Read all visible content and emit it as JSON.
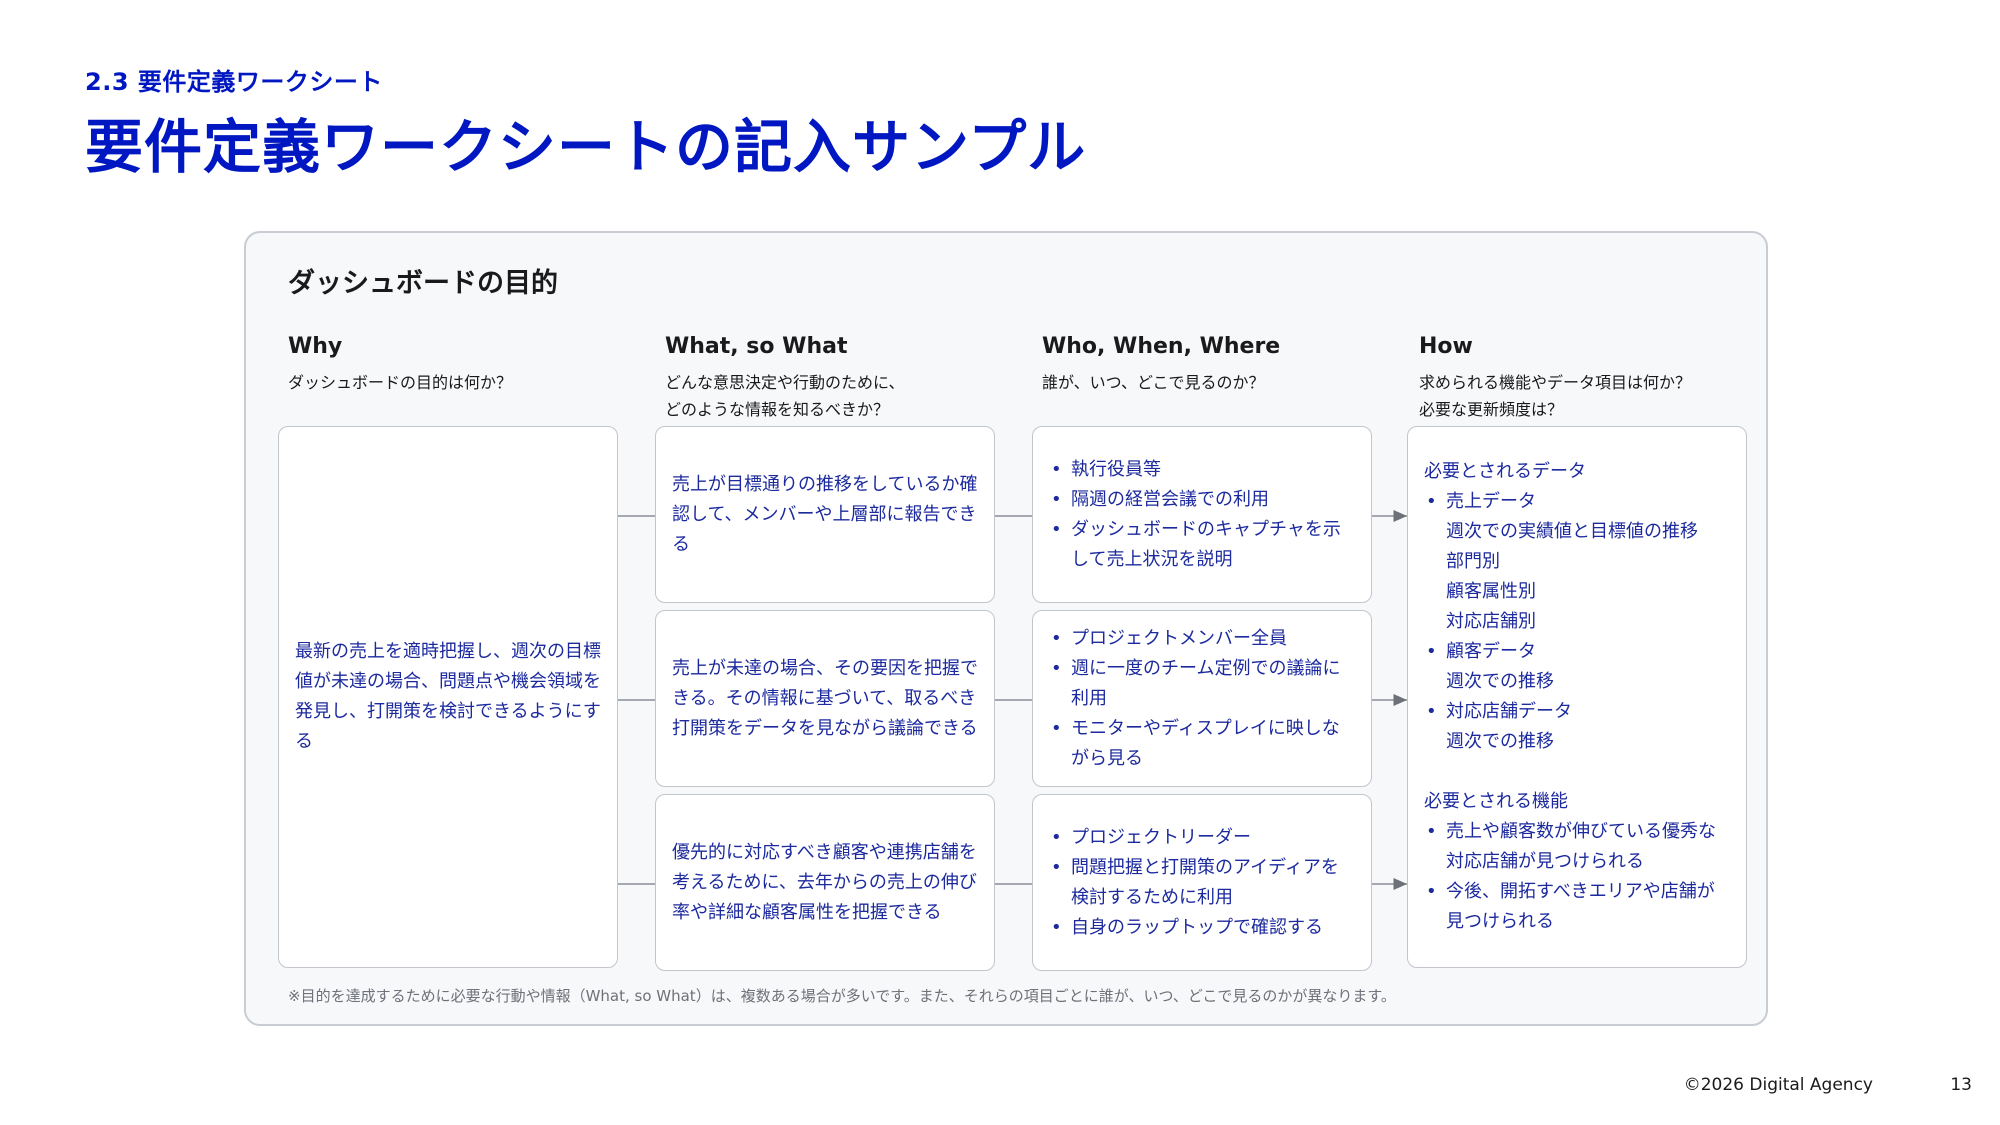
{
  "header": {
    "section_label": "2.3 要件定義ワークシート",
    "title": "要件定義ワークシートの記入サンプル"
  },
  "panel": {
    "title": "ダッシュボードの目的",
    "columns": [
      {
        "heading": "Why",
        "question": "ダッシュボードの目的は何か？"
      },
      {
        "heading": "What, so What",
        "question": "どんな意思決定や行動のために、\nどのような情報を知るべきか？"
      },
      {
        "heading": "Who, When, Where",
        "question": "誰が、いつ、どこで見るのか？"
      },
      {
        "heading": "How",
        "question": "求められる機能やデータ項目は何か？\n必要な更新頻度は？"
      }
    ],
    "why_text": "最新の売上を適時把握し、週次の目標値が未達の場合、問題点や機会領域を発見し、打開策を検討できるようにする",
    "what_items": [
      "売上が目標通りの推移をしているか確認して、メンバーや上層部に報告できる",
      "売上が未達の場合、その要因を把握できる。その情報に基づいて、取るべき打開策をデータを見ながら議論できる",
      "優先的に対応すべき顧客や連携店舗を考えるために、去年からの売上の伸び率や詳細な顧客属性を把握できる"
    ],
    "who_items": [
      [
        "執行役員等",
        "隔週の経営会議での利用",
        "ダッシュボードのキャプチャを示して売上状況を説明"
      ],
      [
        "プロジェクトメンバー全員",
        "週に一度のチーム定例での議論に利用",
        "モニターやディスプレイに映しながら見る"
      ],
      [
        "プロジェクトリーダー",
        "問題把握と打開策のアイディアを検討するために利用",
        "自身のラップトップで確認する"
      ]
    ],
    "how": {
      "data_heading": "必要とされるデータ",
      "data_items": [
        {
          "label": "売上データ",
          "details": [
            "週次での実績値と目標値の推移",
            "部門別",
            "顧客属性別",
            "対応店舗別"
          ]
        },
        {
          "label": "顧客データ",
          "details": [
            "週次での推移"
          ]
        },
        {
          "label": "対応店舗データ",
          "details": [
            "週次での推移"
          ]
        }
      ],
      "feature_heading": "必要とされる機能",
      "feature_items": [
        "売上や顧客数が伸びている優秀な対応店舗が見つけられる",
        "今後、開拓すべきエリアや店舗が見つけられる"
      ]
    },
    "footnote": "※目的を達成するために必要な行動や情報（What, so What）は、複数ある場合が多いです。また、それらの項目ごとに誰が、いつ、どこで見るのかが異なります。"
  },
  "footer": {
    "copyright": "©2026 Digital Agency",
    "page_number": "13"
  },
  "colors": {
    "accent": "#0017c1",
    "body_text": "#1c2a9e",
    "panel_bg": "#f7f8fa",
    "border": "#c2c5cc"
  }
}
